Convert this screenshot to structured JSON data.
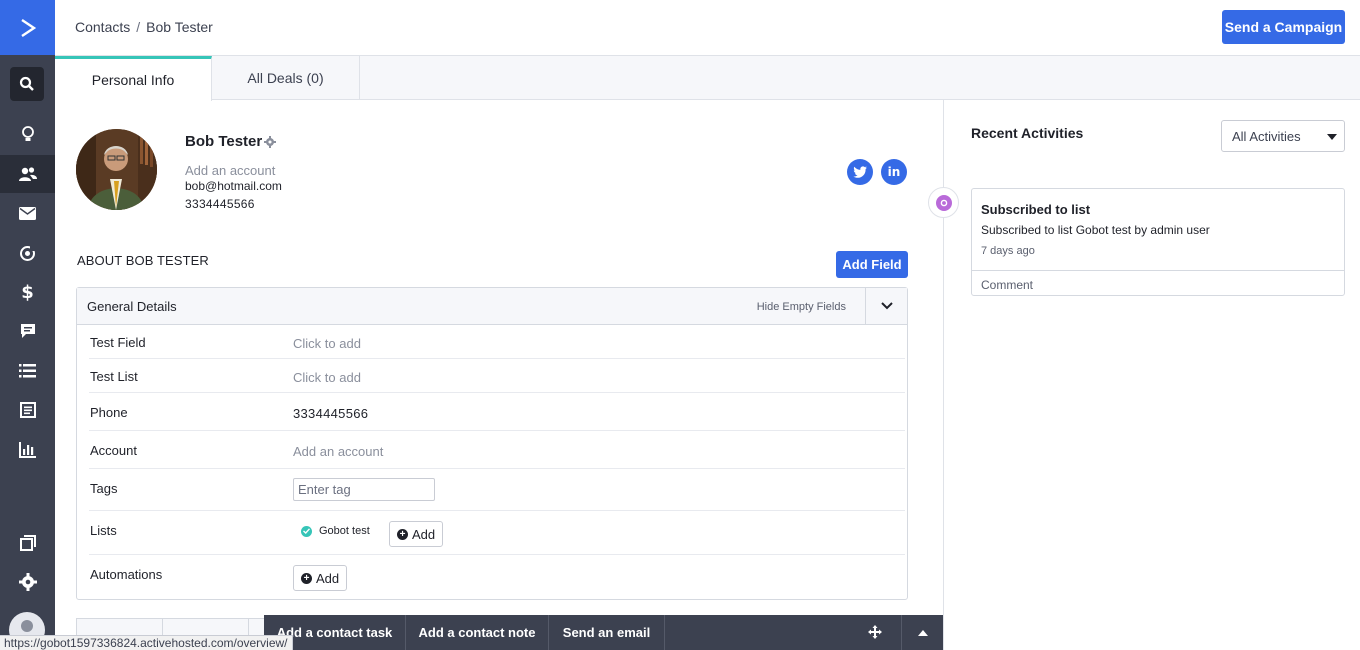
{
  "breadcrumb": {
    "parent": "Contacts",
    "separator": "/",
    "current": "Bob Tester"
  },
  "header": {
    "send_campaign_label": "Send a Campaign"
  },
  "tabs": [
    {
      "label": "Personal Info",
      "active": true
    },
    {
      "label": "All Deals (0)",
      "active": false
    }
  ],
  "contact": {
    "name": "Bob Tester",
    "add_account": "Add an account",
    "email": "bob@hotmail.com",
    "phone": "3334445566"
  },
  "about": {
    "title": "ABOUT BOB TESTER",
    "add_field_label": "Add Field"
  },
  "details": {
    "title": "General Details",
    "hide_empty_label": "Hide Empty Fields",
    "fields": [
      {
        "label": "Test Field",
        "value": "Click to add"
      },
      {
        "label": "Test List",
        "value": "Click to add"
      },
      {
        "label": "Phone",
        "value": "3334445566"
      },
      {
        "label": "Account",
        "value": "Add an account"
      },
      {
        "label": "Tags",
        "placeholder": "Enter tag"
      },
      {
        "label": "Lists",
        "list_name": "Gobot test",
        "add_label": "Add"
      },
      {
        "label": "Automations",
        "add_label": "Add"
      }
    ]
  },
  "recent": {
    "title": "Recent Activities",
    "filter_value": "All Activities",
    "activity": {
      "title": "Subscribed to list",
      "description": "Subscribed to list Gobot test by admin user",
      "time": "7 days ago",
      "comment_label": "Comment"
    }
  },
  "action_bar": {
    "add_task": "Add a contact task",
    "add_note": "Add a contact note",
    "send_email": "Send an email"
  },
  "status_url": "https://gobot1597336824.activehosted.com/overview/",
  "colors": {
    "brand": "#356ae6",
    "nav_bg": "#3c4150",
    "accent_tab": "#36c5b8",
    "list_check": "#36c5b8",
    "activity_dot": "#b96ad9"
  },
  "icons": {
    "nav": [
      "logo-chevron-icon",
      "search-icon",
      "lightbulb-icon",
      "contacts-icon",
      "envelope-icon",
      "automation-icon",
      "dollar-icon",
      "conversations-icon",
      "lists-icon",
      "forms-icon",
      "reports-icon",
      "pages-icon",
      "settings-icon",
      "user-avatar-icon"
    ],
    "social": [
      "twitter-icon",
      "linkedin-icon"
    ]
  }
}
